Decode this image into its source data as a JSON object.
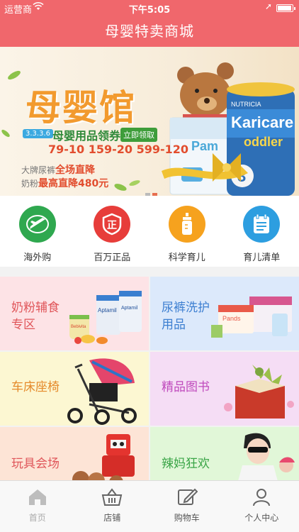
{
  "status_bar": {
    "carrier": "运营商",
    "time": "下午5:05"
  },
  "nav": {
    "title": "母婴特卖商城"
  },
  "banner": {
    "brand": "母婴馆",
    "tag": "3.3.3.6",
    "coupon": "母婴用品领券",
    "coupon_button": "立即领取",
    "steps": "79-10 159-20 599-120",
    "line1_prefix": "大牌尿裤",
    "line1_highlight": "全场直降",
    "line2_prefix": "奶粉",
    "line2_highlight": "最高直降480元",
    "product_brand": "NUTRICIA",
    "product_name": "Karicare",
    "product_sub": "oddler",
    "product_number": "3",
    "diaper_brand": "Pam",
    "dot_count": 2
  },
  "quick_icons": [
    {
      "label": "海外购",
      "icon": "airplane-icon",
      "color": "#2fa84f"
    },
    {
      "label": "百万正品",
      "icon": "shield-icon",
      "color": "#e73d3a"
    },
    {
      "label": "科学育儿",
      "icon": "baby-bottle-icon",
      "color": "#f6a21e"
    },
    {
      "label": "育儿清单",
      "icon": "checklist-icon",
      "color": "#2d9ee0"
    }
  ],
  "categories": [
    {
      "label_line1": "奶粉辅食",
      "label_line2": "专区",
      "bg": "#fde3e6",
      "color": "#e0565a"
    },
    {
      "label_line1": "尿裤洗护",
      "label_line2": "用品",
      "bg": "#dce9fb",
      "color": "#3d7fd1"
    },
    {
      "label_line1": "车床座椅",
      "label_line2": "",
      "bg": "#fcf7d2",
      "color": "#e58a2b"
    },
    {
      "label_line1": "精品图书",
      "label_line2": "",
      "bg": "#f5ddf5",
      "color": "#c04bbd"
    },
    {
      "label_line1": "玩具会场",
      "label_line2": "",
      "bg": "#fde4d6",
      "color": "#e0565a"
    },
    {
      "label_line1": "辣妈狂欢",
      "label_line2": "",
      "bg": "#e1f7d8",
      "color": "#3aa547"
    }
  ],
  "product_art": {
    "aptamil": "Aptamil",
    "bebivita": "Bebivita",
    "pands": "Pands"
  },
  "tabs": [
    {
      "label": "首页",
      "icon": "home-icon",
      "active": true
    },
    {
      "label": "店铺",
      "icon": "basket-icon",
      "active": false
    },
    {
      "label": "购物车",
      "icon": "edit-icon",
      "active": false
    },
    {
      "label": "个人中心",
      "icon": "user-icon",
      "active": false
    }
  ]
}
